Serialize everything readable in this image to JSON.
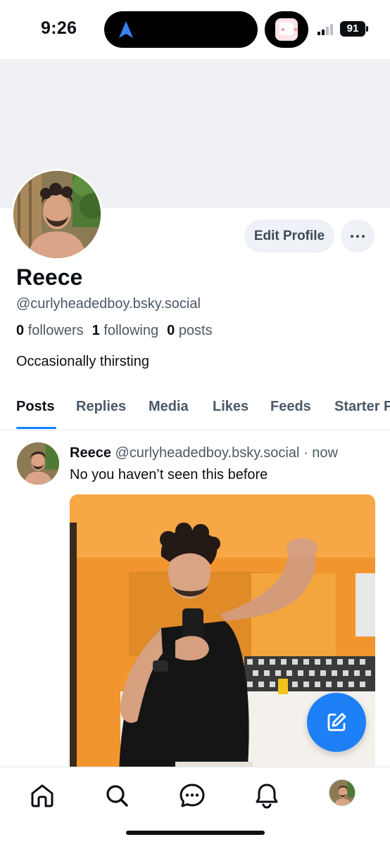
{
  "status_bar": {
    "time": "9:26",
    "battery": "91",
    "nav_arrow_color": "#3b82f6"
  },
  "profile": {
    "name": "Reece",
    "handle": "@curlyheadedboy.bsky.social",
    "followers_count": "0",
    "followers_label": "followers",
    "following_count": "1",
    "following_label": "following",
    "posts_count": "0",
    "posts_label": "posts",
    "bio": "Occasionally thirsting",
    "edit_profile_label": "Edit Profile"
  },
  "tabs": [
    {
      "label": "Posts",
      "active": true
    },
    {
      "label": "Replies",
      "active": false
    },
    {
      "label": "Media",
      "active": false
    },
    {
      "label": "Likes",
      "active": false
    },
    {
      "label": "Feeds",
      "active": false
    },
    {
      "label": "Starter Packs",
      "active": false
    }
  ],
  "post": {
    "author": "Reece",
    "handle": "@curlyheadedboy.bsky.social",
    "separator": "·",
    "time": "now",
    "text": "No you haven’t seen this before"
  },
  "bottom_nav": [
    "home-icon",
    "search-icon",
    "chat-icon",
    "notifications-icon",
    "profile-avatar"
  ],
  "colors": {
    "accent": "#1083fe",
    "fab": "#1d80f6",
    "muted_text": "#4b5866",
    "banner": "#eef0f3"
  }
}
